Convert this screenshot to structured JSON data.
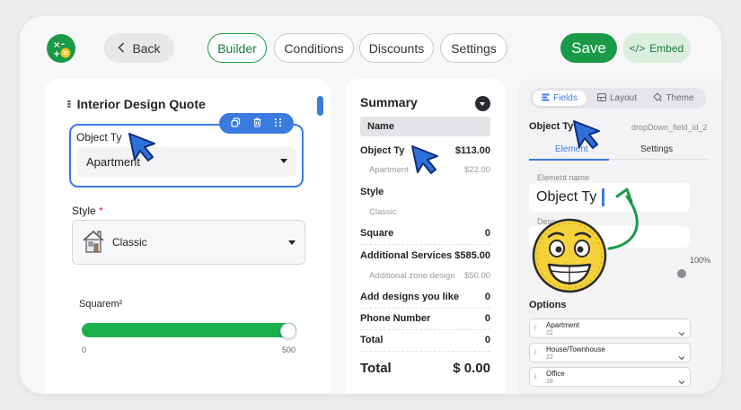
{
  "toolbar": {
    "back_label": "Back",
    "tabs": [
      {
        "label": "Builder",
        "active": true
      },
      {
        "label": "Conditions",
        "active": false
      },
      {
        "label": "Discounts",
        "active": false
      },
      {
        "label": "Settings",
        "active": false
      }
    ],
    "save_label": "Save",
    "embed_label": "Embed",
    "embed_icon_text": "</>"
  },
  "form": {
    "title": "Interior Design Quote",
    "selected_field": {
      "label": "Object Ty",
      "value": "Apartment"
    },
    "style_field": {
      "label": "Style",
      "required_mark": "*",
      "value": "Classic"
    },
    "square_field": {
      "label": "Squarem²",
      "min": "0",
      "max": "500",
      "fill_fraction": 1.0
    }
  },
  "summary": {
    "title": "Summary",
    "header": "Name",
    "rows": [
      {
        "label": "Object Ty",
        "value": "$113.00"
      },
      {
        "sub_label": "Apartment",
        "sub_value": "$22.00"
      },
      {
        "label": "Style",
        "value": ""
      },
      {
        "sub_label": "Classic",
        "sub_value": ""
      },
      {
        "label": "Square",
        "value": "0"
      },
      {
        "label": "Additional Services",
        "value": "$585.00"
      },
      {
        "sub_label": "Additional zone design",
        "sub_value": "$50.00"
      },
      {
        "label": "Add designs you like",
        "value": "0"
      },
      {
        "label": "Phone Number",
        "value": "0"
      },
      {
        "label": "Total",
        "value": "0"
      }
    ],
    "total_label": "Total",
    "total_value": "$ 0.00"
  },
  "properties": {
    "tabs": [
      {
        "label": "Fields",
        "active": true
      },
      {
        "label": "Layout",
        "active": false
      },
      {
        "label": "Theme",
        "active": false
      }
    ],
    "field_title": "Object Ty",
    "field_id": "dropDown_field_id_2",
    "subtabs": [
      {
        "label": "Element",
        "active": true
      },
      {
        "label": "Settings",
        "active": false
      }
    ],
    "element_name_label": "Element name",
    "element_name_value": "Object Ty",
    "desc_label": "Desc",
    "width_value": "100%",
    "options_title": "Options",
    "options": [
      {
        "name": "Apartment",
        "num": "22"
      },
      {
        "name": "House/Townhouse",
        "num": "22"
      },
      {
        "name": "Office",
        "num": "18"
      }
    ]
  },
  "colors": {
    "brand_green": "#1a9a47",
    "accent_blue": "#3b7be0",
    "slider_green": "#1ab04e"
  },
  "icons": [
    "calculator-logo-icon",
    "chevron-left-icon",
    "code-icon",
    "copy-icon",
    "trash-icon",
    "drag-handle-icon",
    "house-icon",
    "chevron-down-icon",
    "fields-icon",
    "layout-icon",
    "theme-icon",
    "mouse-cursor-icon",
    "grinning-emoji-icon",
    "curved-arrow-icon"
  ]
}
